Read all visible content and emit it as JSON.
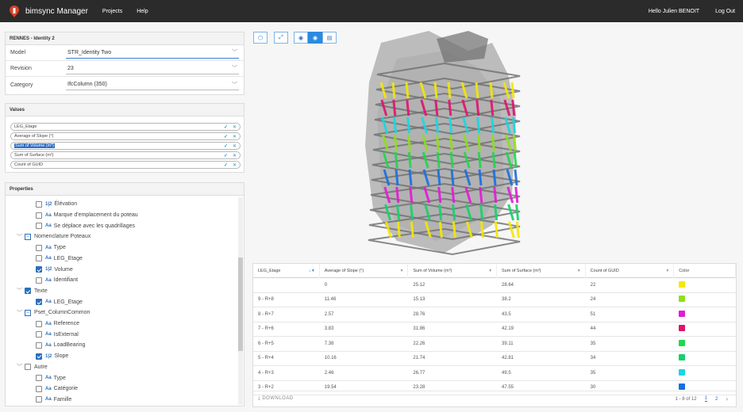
{
  "app": {
    "brand": "bimsync Manager",
    "nav": [
      "Projects",
      "Help"
    ],
    "user": "Hello Julien BENOIT",
    "logout": "Log Out"
  },
  "model_panel": {
    "title": "RENNES - Identity 2",
    "fields": [
      {
        "label": "Model",
        "value": "STR_Identity Two"
      },
      {
        "label": "Revision",
        "value": "23"
      },
      {
        "label": "Category",
        "value": "IfcColumn (350)"
      }
    ]
  },
  "values_panel": {
    "title": "Values",
    "items": [
      "LEG_Etage",
      "Average of Slope (°)",
      "Sum of Volume (m³)",
      "Sum of Surface (m²)",
      "Count of GUID"
    ]
  },
  "properties_panel": {
    "title": "Properties",
    "rows": [
      {
        "level": 2,
        "kind": "num",
        "checked": false,
        "label": "Élévation"
      },
      {
        "level": 2,
        "kind": "text",
        "checked": false,
        "label": "Marque d'emplacement du poteau"
      },
      {
        "level": 2,
        "kind": "text",
        "checked": false,
        "label": "Se déplace avec les quadrillages"
      },
      {
        "level": 1,
        "kind": "group",
        "checked": false,
        "label": "Nomenclature Poteaux",
        "indeterminate": true
      },
      {
        "level": 2,
        "kind": "text",
        "checked": false,
        "label": "Type"
      },
      {
        "level": 2,
        "kind": "text",
        "checked": false,
        "label": "LEG_Etage"
      },
      {
        "level": 2,
        "kind": "num",
        "checked": true,
        "label": "Volume"
      },
      {
        "level": 2,
        "kind": "text",
        "checked": false,
        "label": "Identifiant"
      },
      {
        "level": 1,
        "kind": "group",
        "checked": true,
        "label": "Texte"
      },
      {
        "level": 2,
        "kind": "text",
        "checked": true,
        "label": "LEG_Etage"
      },
      {
        "level": 1,
        "kind": "group",
        "checked": false,
        "label": "Pset_ColumnCommon",
        "indeterminate": true
      },
      {
        "level": 2,
        "kind": "text",
        "checked": false,
        "label": "Reference"
      },
      {
        "level": 2,
        "kind": "text",
        "checked": false,
        "label": "IsExternal"
      },
      {
        "level": 2,
        "kind": "text",
        "checked": false,
        "label": "LoadBearing"
      },
      {
        "level": 2,
        "kind": "num",
        "checked": true,
        "label": "Slope"
      },
      {
        "level": 1,
        "kind": "group",
        "checked": false,
        "label": "Autre"
      },
      {
        "level": 2,
        "kind": "text",
        "checked": false,
        "label": "Type"
      },
      {
        "level": 2,
        "kind": "text",
        "checked": false,
        "label": "Catégorie"
      },
      {
        "level": 2,
        "kind": "text",
        "checked": false,
        "label": "Famille"
      }
    ],
    "text_prefix": "Aa",
    "num_prefix": "1|2"
  },
  "toolbar": {
    "icons": [
      "cube-icon",
      "expand-icon",
      "eye-icon",
      "eye-icon",
      "report-icon"
    ]
  },
  "table": {
    "columns": [
      "LEG_Etage",
      "Average of Slope (°)",
      "Sum of Volume (m³)",
      "Sum of Surface (m²)",
      "Count of GUID",
      "Color"
    ],
    "rows": [
      {
        "etage": "",
        "slope": "0",
        "volume": "25.12",
        "surface": "28.64",
        "count": "22",
        "color": "#f5e800"
      },
      {
        "etage": "9 - R+8",
        "slope": "11.46",
        "volume": "15.13",
        "surface": "38.2",
        "count": "24",
        "color": "#8ee01a"
      },
      {
        "etage": "8 - R+7",
        "slope": "2.57",
        "volume": "28.76",
        "surface": "43.5",
        "count": "51",
        "color": "#e21ad7"
      },
      {
        "etage": "7 - R+6",
        "slope": "3.83",
        "volume": "31.86",
        "surface": "42.19",
        "count": "44",
        "color": "#e0136d"
      },
      {
        "etage": "6 - R+5",
        "slope": "7.38",
        "volume": "22.26",
        "surface": "39.11",
        "count": "35",
        "color": "#22d64c"
      },
      {
        "etage": "5 - R+4",
        "slope": "10.16",
        "volume": "21.74",
        "surface": "42.81",
        "count": "34",
        "color": "#18d06a"
      },
      {
        "etage": "4 - R+3",
        "slope": "2.46",
        "volume": "26.77",
        "surface": "49.5",
        "count": "35",
        "color": "#1ad7e0"
      },
      {
        "etage": "3 - R+2",
        "slope": "19.54",
        "volume": "23.28",
        "surface": "47.55",
        "count": "30",
        "color": "#1a6fe0"
      }
    ],
    "download": "DOWNLOAD",
    "pagination": {
      "range": "1 - 8 of 12",
      "pages": [
        "1",
        "2"
      ]
    }
  }
}
